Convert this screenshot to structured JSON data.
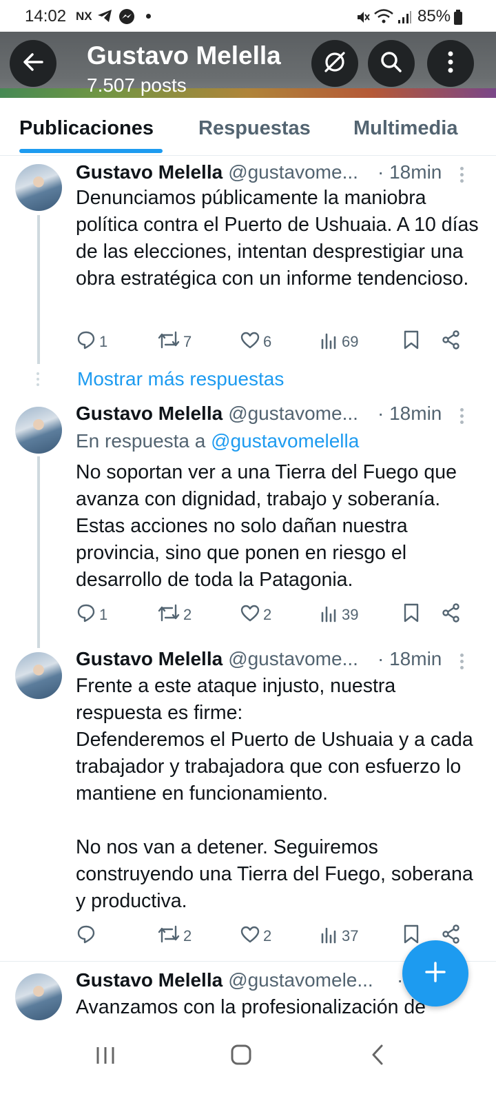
{
  "status_bar": {
    "time": "14:02",
    "app_tag": "NX",
    "battery": "85%"
  },
  "header": {
    "title": "Gustavo Melella",
    "subtitle": "7.507 posts"
  },
  "tabs": [
    {
      "label": "Publicaciones",
      "active": true
    },
    {
      "label": "Respuestas",
      "active": false
    },
    {
      "label": "Multimedia",
      "active": false
    }
  ],
  "show_more": "Mostrar más respuestas",
  "posts": [
    {
      "name": "Gustavo Melella",
      "handle": "@gustavome...",
      "time": "· 18min",
      "text": "Denunciamos públicamente la maniobra política contra el Puerto de Ushuaia. A 10 días de las elecciones, intentan desprestigiar una obra estratégica con un informe tendencioso.",
      "replies": "1",
      "reposts": "7",
      "likes": "6",
      "views": "69"
    },
    {
      "name": "Gustavo Melella",
      "handle": "@gustavome...",
      "time": "· 18min",
      "reply_prefix": "En respuesta a ",
      "reply_handle": "@gustavomelella",
      "text": "No soportan ver a una Tierra del Fuego que avanza con dignidad, trabajo y soberanía. Estas acciones no solo dañan nuestra provincia, sino que ponen en riesgo el desarrollo de toda la Patagonia.",
      "replies": "1",
      "reposts": "2",
      "likes": "2",
      "views": "39"
    },
    {
      "name": "Gustavo Melella",
      "handle": "@gustavome...",
      "time": "· 18min",
      "text": "Frente a este ataque injusto, nuestra respuesta es firme:\nDefenderemos el Puerto de Ushuaia y a cada trabajador y trabajadora que con esfuerzo lo mantiene en funcionamiento.\n\nNo nos van a detener. Seguiremos construyendo una Tierra del Fuego, soberana y productiva.",
      "replies": "",
      "reposts": "2",
      "likes": "2",
      "views": "37"
    },
    {
      "name": "Gustavo Melella",
      "handle": "@gustavomele...",
      "time": "·",
      "text": "Avanzamos con la profesionalización de"
    }
  ],
  "colors": {
    "accent": "#1d9bf0",
    "text": "#0f1419",
    "muted": "#536471"
  },
  "icons": [
    "back-arrow-icon",
    "grok-icon",
    "search-icon",
    "more-vertical-icon",
    "reply-icon",
    "repost-icon",
    "like-icon",
    "views-icon",
    "bookmark-icon",
    "share-icon",
    "compose-plus-icon"
  ]
}
